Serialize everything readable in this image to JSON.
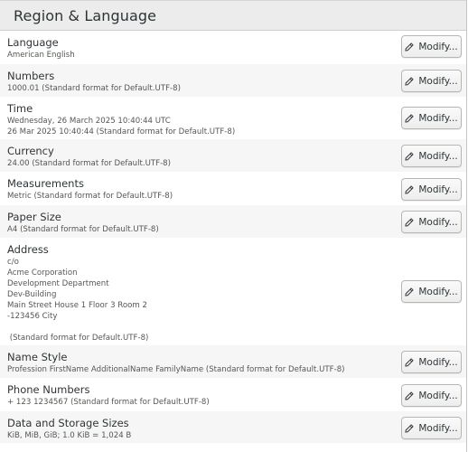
{
  "header": {
    "title": "Region & Language"
  },
  "button_icon": "pencil-icon",
  "button_label": "Modify...",
  "rows": [
    {
      "title": "Language",
      "lines": [
        "American English"
      ]
    },
    {
      "title": "Numbers",
      "lines": [
        "1000.01 (Standard format for Default.UTF-8)"
      ]
    },
    {
      "title": "Time",
      "lines": [
        "Wednesday, 26 March 2025 10:40:44 UTC",
        "26 Mar 2025 10:40:44 (Standard format for Default.UTF-8)"
      ]
    },
    {
      "title": "Currency",
      "lines": [
        "24.00 (Standard format for Default.UTF-8)"
      ]
    },
    {
      "title": "Measurements",
      "lines": [
        "Metric (Standard format for Default.UTF-8)"
      ]
    },
    {
      "title": "Paper Size",
      "lines": [
        "A4 (Standard format for Default.UTF-8)"
      ]
    },
    {
      "title": "Address",
      "lines": [
        "c/o",
        "Acme Corporation",
        "Development Department",
        "Dev-Building",
        "Main Street House 1 Floor 3 Room 2",
        "-123456 City",
        "",
        " (Standard format for Default.UTF-8)"
      ]
    },
    {
      "title": "Name Style",
      "lines": [
        "Profession FirstName AdditionalName FamilyName (Standard format for Default.UTF-8)"
      ]
    },
    {
      "title": "Phone Numbers",
      "lines": [
        "+ 123 1234567 (Standard format for Default.UTF-8)"
      ]
    },
    {
      "title": "Data and Storage Sizes",
      "lines": [
        "KiB, MiB, GiB; 1.0 KiB = 1,024 B"
      ]
    }
  ]
}
